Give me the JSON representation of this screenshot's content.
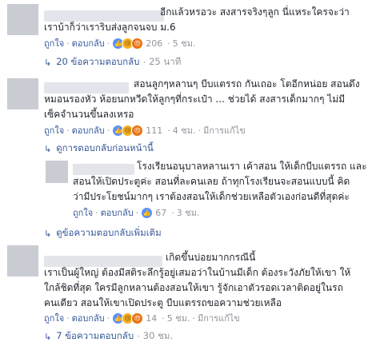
{
  "comments": [
    {
      "text": "อีกแล้วหรอวะ สงสารจริงๆลูก นี่แหระใครจะว่า\nเราบ้าก็ว่าเราริบส่งลูกจนจบ ม.6",
      "like": "ถูกใจ",
      "reply": "ตอบกลับ",
      "count": "206",
      "time": "5 ชม.",
      "replies_label": "20 ข้อความตอบกลับ",
      "replies_time": "25 นาที"
    },
    {
      "text": "สอนลูกๆหลานๆ บีบแตรรถ กันเถอะ โตอีกหน่อย สอนดึง\nหมอนรองหัว ห้อยนกหวีดให้ลูกๆที่กระเป๋า ... ช่วยได้ สงสารเด็กมากๆ ไม่มี\nเซ็คจำนวนขึ้นลงเหรอ",
      "like": "ถูกใจ",
      "reply": "ตอบกลับ",
      "count": "111",
      "time": "4 ชม.",
      "edited": "มีการแก้ไข",
      "prev_replies": "ดูการตอบกลับก่อนหน้านี้",
      "reply_item": {
        "text": "โรงเรียนอนุบาลหลานเรา เค้าสอน ให้เด็กบีบแตรรถ และ\nสอนให้เปิดประตูค่ะ สอนที่ละคนเลย ถ้าทุกโรงเรียนจะสอนแบบนี้ คิด\nว่ามีประโยชน์มากๆ เราต้องสอนให้เด็กช่วยเหลือตัวเองก่อนดีที่สุดค่ะ",
        "like": "ถูกใจ",
        "reply": "ตอบกลับ",
        "count": "67",
        "time": "3 ชม."
      },
      "more_replies": "ดูข้อความตอบกลับเพิ่มเติม"
    },
    {
      "text": "เกิดขึ้นบ่อยมากกรณีนี้\nเราเป็นผู้ใหญ่ ต้องมีสติระลึกรู้อยู่เสมอว่าในบ้านมีเด็ก ต้องระวังภัยให้เขา ให้\nใกล้ชิดที่สุด ใครมีลูกหลานต้องสอนให้เขา รู้จักเอาตัวรอดเวลาติดอยู่ในรถ\nคนเดียว สอนให้เขาเปิดประตู บีบแตรรถขอความช่วยเหลือ",
      "like": "ถูกใจ",
      "reply": "ตอบกลับ",
      "count": "14",
      "time": "5 ชม.",
      "edited": "มีการแก้ไข",
      "replies_label": "7 ข้อความตอบกลับ",
      "replies_time": "30 ชม."
    }
  ],
  "colors": {
    "link": "#365899",
    "muted": "#90949c",
    "text": "#1d2129",
    "like_blue": "#5890ff"
  }
}
